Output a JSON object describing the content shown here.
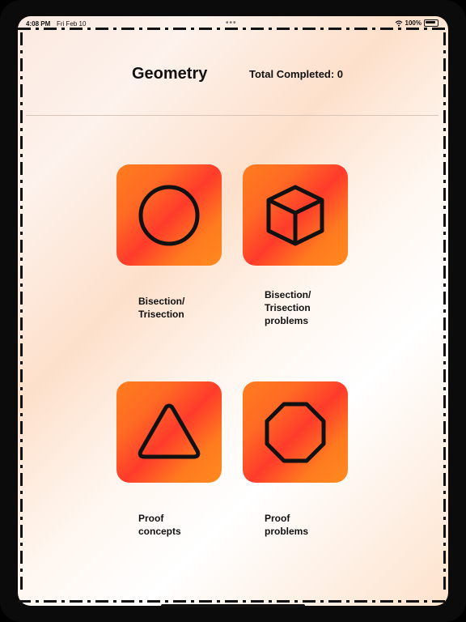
{
  "status": {
    "time": "4:08 PM",
    "date": "Fri Feb 10",
    "dots": "•••",
    "battery": "100%"
  },
  "header": {
    "title": "Geometry",
    "total_completed": "Total Completed: 0"
  },
  "topics": [
    {
      "label": "Bisection/\nTrisection",
      "icon": "circle-icon"
    },
    {
      "label": "Bisection/\nTrisection\nproblems",
      "icon": "cube-icon"
    },
    {
      "label": "Proof\nconcepts",
      "icon": "triangle-icon"
    },
    {
      "label": "Proof\nproblems",
      "icon": "octagon-icon"
    }
  ],
  "colors": {
    "card_gradient_start": "#ff7d1e",
    "card_gradient_mid": "#ff3b2b",
    "text": "#111111"
  }
}
